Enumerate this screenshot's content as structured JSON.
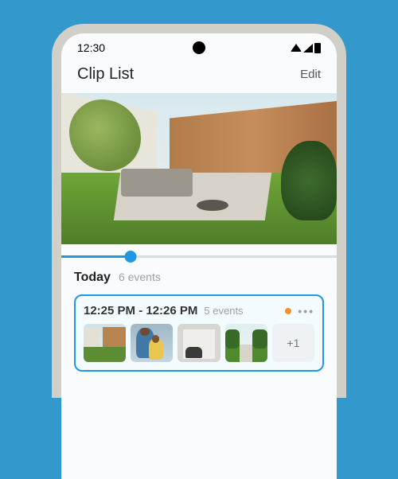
{
  "status": {
    "time": "12:30"
  },
  "header": {
    "title": "Clip List",
    "edit_label": "Edit"
  },
  "scrubber": {
    "progress_pct": 25
  },
  "section": {
    "title": "Today",
    "subtitle": "6 events"
  },
  "card": {
    "time_range": "12:25 PM - 12:26 PM",
    "count": "5 events",
    "more_label": "+1",
    "dot_color": "#f4902a"
  },
  "colors": {
    "accent": "#2196e3"
  }
}
